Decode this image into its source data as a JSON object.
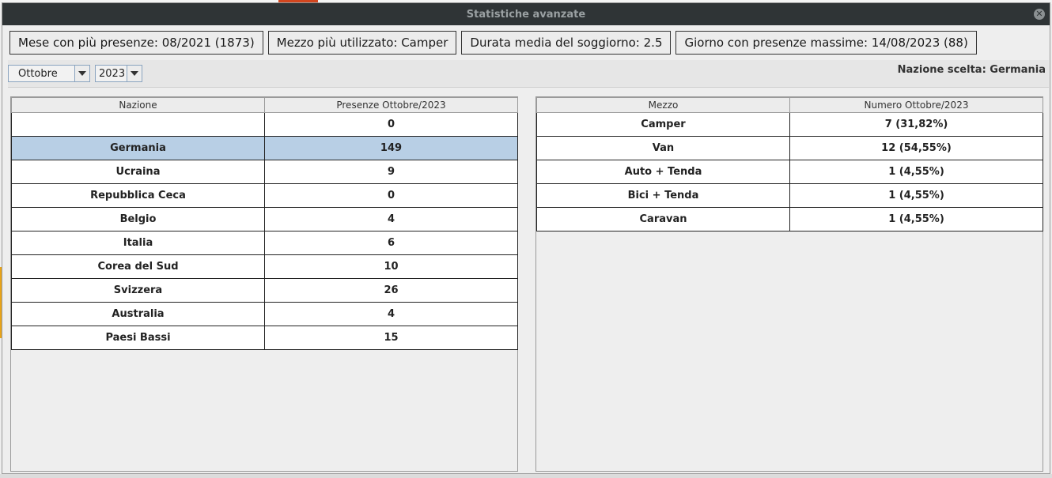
{
  "window": {
    "title": "Statistiche avanzate"
  },
  "stats": {
    "top_month": "Mese con più presenze: 08/2021 (1873)",
    "top_vehicle": "Mezzo più utilizzato: Camper",
    "avg_stay": "Durata media del soggiorno: 2.5",
    "top_day": "Giorno con presenze massime: 14/08/2023 (88)"
  },
  "filters": {
    "month": "Ottobre",
    "year": "2023",
    "selected_country": "Nazione scelta: Germania"
  },
  "countries_table": {
    "columns": [
      "Nazione",
      "Presenze Ottobre/2023"
    ],
    "rows": [
      {
        "name": "",
        "value": "0"
      },
      {
        "name": "Germania",
        "value": "149",
        "selected": true
      },
      {
        "name": "Ucraina",
        "value": "9"
      },
      {
        "name": "Repubblica Ceca",
        "value": "0"
      },
      {
        "name": "Belgio",
        "value": "4"
      },
      {
        "name": "Italia",
        "value": "6"
      },
      {
        "name": "Corea del Sud",
        "value": "10"
      },
      {
        "name": "Svizzera",
        "value": "26"
      },
      {
        "name": "Australia",
        "value": "4"
      },
      {
        "name": "Paesi Bassi",
        "value": "15"
      }
    ]
  },
  "vehicles_table": {
    "columns": [
      "Mezzo",
      "Numero Ottobre/2023"
    ],
    "rows": [
      {
        "name": "Camper",
        "value": "7 (31,82%)"
      },
      {
        "name": "Van",
        "value": "12 (54,55%)"
      },
      {
        "name": "Auto + Tenda",
        "value": "1 (4,55%)"
      },
      {
        "name": "Bici + Tenda",
        "value": "1 (4,55%)"
      },
      {
        "name": "Caravan",
        "value": "1 (4,55%)"
      }
    ]
  },
  "icons": {
    "close": "close-icon",
    "dropdown": "chevron-down-icon"
  },
  "colors": {
    "titlebar": "#2f3436",
    "selection": "#b8cfe5"
  }
}
